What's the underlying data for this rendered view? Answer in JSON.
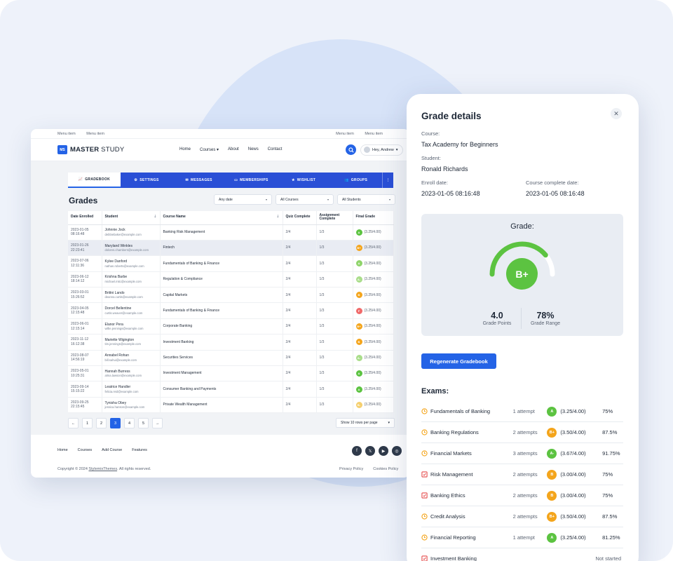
{
  "topbar": {
    "left": [
      "Menu item",
      "Menu item"
    ],
    "right": [
      "Menu item",
      "Menu item"
    ]
  },
  "brand": {
    "mark": "MS",
    "name_bold": "MASTER",
    "name_light": "STUDY"
  },
  "nav": [
    "Home",
    "Courses",
    "About",
    "News",
    "Contact"
  ],
  "user": {
    "greeting": "Hey, Andrew"
  },
  "tabs": [
    {
      "label": "GRADEBOOK",
      "icon": "chart-icon"
    },
    {
      "label": "SETTINGS",
      "icon": "gear-icon"
    },
    {
      "label": "MESSAGES",
      "icon": "mail-icon"
    },
    {
      "label": "MEMBERSHIPS",
      "icon": "card-icon"
    },
    {
      "label": "WISHLIST",
      "icon": "star-icon"
    },
    {
      "label": "GROUPS",
      "icon": "users-icon"
    }
  ],
  "page_title": "Grades",
  "filters": [
    "Any date",
    "All Courses",
    "All Students"
  ],
  "table": {
    "headers": [
      "Date Enrolled",
      "Student",
      "Course Name",
      "Quiz Complete",
      "Assignment Complete",
      "Final Grade"
    ],
    "rows": [
      {
        "date": "2023-01-05",
        "time": "08:16:48",
        "name": "Johnnie Jock",
        "email": "debbiebaker@example.com",
        "course": "Banking Risk Management",
        "quiz": "2/4",
        "assign": "1/3",
        "grade": "A",
        "color": "#5cc341",
        "score": "(3.25/4.00)"
      },
      {
        "date": "2023-01-26",
        "time": "22:23:41",
        "name": "Maryland Winkles",
        "email": "dolores.chambers@example.com",
        "course": "Fintech",
        "quiz": "2/4",
        "assign": "1/3",
        "grade": "B+",
        "color": "#f4a51c",
        "score": "(3.25/4.00)"
      },
      {
        "date": "2023-07-06",
        "time": "12:11:36",
        "name": "Kylee Danford",
        "email": "nathan.roberts@example.com",
        "course": "Fundamentals of Banking & Finance",
        "quiz": "2/4",
        "assign": "1/3",
        "grade": "A",
        "color": "#8fd46a",
        "score": "(3.25/4.00)"
      },
      {
        "date": "2023-06-12",
        "time": "18:14:12",
        "name": "Krishna Barbe",
        "email": "michael.mitc@example.com",
        "course": "Regulation & Compliance",
        "quiz": "2/4",
        "assign": "1/3",
        "grade": "A-",
        "color": "#a9dd8a",
        "score": "(3.25/4.00)"
      },
      {
        "date": "2023-03-01",
        "time": "15:26:52",
        "name": "Brittni Lando",
        "email": "deanna.curtis@example.com",
        "course": "Capital Markets",
        "quiz": "2/4",
        "assign": "1/3",
        "grade": "B",
        "color": "#f4a51c",
        "score": "(3.25/4.00)"
      },
      {
        "date": "2023-04-05",
        "time": "12:15:48",
        "name": "Dorcel Bellentine",
        "email": "curtis.weaver@example.com",
        "course": "Fundamentals of Banking & Finance",
        "quiz": "2/4",
        "assign": "1/3",
        "grade": "F",
        "color": "#f06a6a",
        "score": "(3.25/4.00)"
      },
      {
        "date": "2023-06-01",
        "time": "12:15:14",
        "name": "Elanor Pera",
        "email": "willie.jennings@example.com",
        "course": "Corporate Banking",
        "quiz": "2/4",
        "assign": "1/3",
        "grade": "B+",
        "color": "#f4a51c",
        "score": "(3.25/4.00)"
      },
      {
        "date": "2023-11-12",
        "time": "16:12:38",
        "name": "Mariette Wigington",
        "email": "tim.jennings@example.com",
        "course": "Investment Banking",
        "quiz": "2/4",
        "assign": "1/3",
        "grade": "B",
        "color": "#f4a51c",
        "score": "(3.25/4.00)"
      },
      {
        "date": "2023-08-07",
        "time": "14:56:19",
        "name": "Annabel Rohan",
        "email": "bill.sahui@example.com",
        "course": "Securities Services",
        "quiz": "2/4",
        "assign": "1/3",
        "grade": "A-",
        "color": "#a9dd8a",
        "score": "(3.25/4.00)"
      },
      {
        "date": "2023-05-01",
        "time": "10:25:31",
        "name": "Hannah Burress",
        "email": "alma.lawson@example.com",
        "course": "Investment Management",
        "quiz": "2/4",
        "assign": "1/3",
        "grade": "A",
        "color": "#5cc341",
        "score": "(3.25/4.00)"
      },
      {
        "date": "2023-09-14",
        "time": "15:15:22",
        "name": "Leatrice Handler",
        "email": "felicia.reid@example.com",
        "course": "Consumer Banking and Payments",
        "quiz": "2/4",
        "assign": "1/3",
        "grade": "A",
        "color": "#5cc341",
        "score": "(3.25/4.00)"
      },
      {
        "date": "2023-09-25",
        "time": "22:15:45",
        "name": "Tynisha Obey",
        "email": "jessica.hanson@example.com",
        "course": "Private Wealth Management",
        "quiz": "2/4",
        "assign": "1/3",
        "grade": "B-",
        "color": "#f5cf6e",
        "score": "(3.25/4.00)"
      }
    ]
  },
  "pagination": {
    "pages": [
      "1",
      "2",
      "3",
      "4",
      "5"
    ],
    "current": "3",
    "prev": "←",
    "next": "→",
    "rows_per_page": "Show 10 rows per page"
  },
  "footer": {
    "links": [
      "Home",
      "Courses",
      "Add Course",
      "Features"
    ],
    "copyright_prefix": "Copyright © 2024 ",
    "copyright_link": "StylemixThemes",
    "copyright_suffix": ". All rights reserved.",
    "policies": [
      "Privacy Policy",
      "Cookies Policy"
    ],
    "socials": [
      "facebook-icon",
      "x-icon",
      "youtube-icon",
      "instagram-icon"
    ]
  },
  "details": {
    "title": "Grade details",
    "course_label": "Course:",
    "course": "Tax Academy for Beginners",
    "student_label": "Student:",
    "student": "Ronald Richards",
    "enroll_label": "Enroll date:",
    "enroll": "2023-01-05 08:16:48",
    "complete_label": "Course complete date:",
    "complete": "2023-01-05 08:16:48",
    "grade_label": "Grade:",
    "grade": "B+",
    "grade_fraction": 0.78,
    "grade_color": "#5cc341",
    "points": "4.0",
    "points_label": "Grade Points",
    "range": "78%",
    "range_label": "Grade Range",
    "regen_label": "Regenerate Gradebook",
    "exams_label": "Exams:",
    "exams": [
      {
        "name": "Fundamentals of Banking",
        "attempts": "1 attempt",
        "grade": "A",
        "color": "#5cc341",
        "score": "(3.25/4.00)",
        "pct": "75%",
        "icon": "clock-icon"
      },
      {
        "name": "Banking Regulations",
        "attempts": "2 attempts",
        "grade": "B+",
        "color": "#f4a51c",
        "score": "(3.50/4.00)",
        "pct": "87.5%",
        "icon": "clock-icon"
      },
      {
        "name": "Financial Markets",
        "attempts": "3 attempts",
        "grade": "A-",
        "color": "#5cc341",
        "score": "(3.67/4.00)",
        "pct": "91.75%",
        "icon": "clock-icon"
      },
      {
        "name": "Risk Management",
        "attempts": "2 attempts",
        "grade": "B",
        "color": "#f4a51c",
        "score": "(3.00/4.00)",
        "pct": "75%",
        "icon": "assignment-icon"
      },
      {
        "name": "Banking Ethics",
        "attempts": "2 attempts",
        "grade": "B",
        "color": "#f4a51c",
        "score": "(3.00/4.00)",
        "pct": "75%",
        "icon": "assignment-icon"
      },
      {
        "name": "Credit Analysis",
        "attempts": "2 attempts",
        "grade": "B+",
        "color": "#f4a51c",
        "score": "(3.50/4.00)",
        "pct": "87.5%",
        "icon": "clock-icon"
      },
      {
        "name": "Financial Reporting",
        "attempts": "1 attempt",
        "grade": "A",
        "color": "#5cc341",
        "score": "(3.25/4.00)",
        "pct": "81.25%",
        "icon": "clock-icon"
      },
      {
        "name": "Investment Banking",
        "attempts": "",
        "grade": "",
        "color": "",
        "score": "",
        "pct": "",
        "status": "Not started",
        "icon": "assignment-icon"
      }
    ]
  }
}
